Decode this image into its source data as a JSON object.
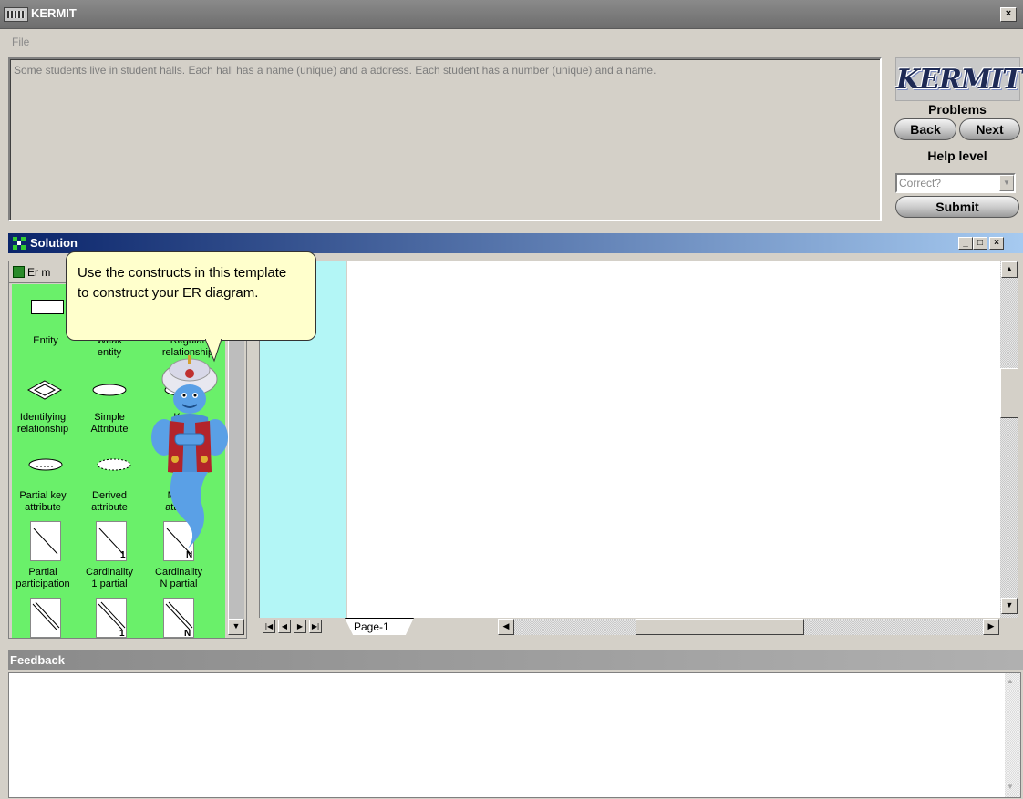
{
  "window": {
    "title": "KERMIT",
    "close_label": "×"
  },
  "menu": {
    "items": [
      {
        "label": "File"
      }
    ]
  },
  "problem": {
    "text": "Some students live in student halls. Each hall has a name (unique) and a address. Each student has a number (unique) and a name."
  },
  "sidebar": {
    "logo_text": "KERMIT",
    "problems_label": "Problems",
    "back_label": "Back",
    "next_label": "Next",
    "help_level_label": "Help level",
    "help_level_value": "Correct?",
    "submit_label": "Submit"
  },
  "solution": {
    "title": "Solution",
    "minimize": "_",
    "maximize": "□",
    "close": "×",
    "palette_title": "Er m",
    "palette": [
      {
        "label": [
          "Entity"
        ]
      },
      {
        "label": [
          "Weak",
          "entity"
        ]
      },
      {
        "label": [
          "Regular",
          "relationship"
        ]
      },
      {
        "label": [
          "Identifying",
          "relationship"
        ]
      },
      {
        "label": [
          "Simple",
          "Attribute"
        ]
      },
      {
        "label": [
          "K",
          ""
        ]
      },
      {
        "label": [
          "Partial key",
          "attribute"
        ]
      },
      {
        "label": [
          "Derived",
          "attribute"
        ]
      },
      {
        "label": [
          "Multiva",
          "attribute"
        ]
      },
      {
        "label": [
          "Partial",
          "participation"
        ]
      },
      {
        "label": [
          "Cardinality",
          "1 partial"
        ]
      },
      {
        "label": [
          "Cardinality",
          "N partial"
        ]
      }
    ],
    "cardinality_marks": {
      "one": "1",
      "n": "N"
    },
    "page_tab": "Page-1"
  },
  "genie": {
    "tip": "Use the constructs in this template to construct your ER diagram."
  },
  "feedback": {
    "title": "Feedback",
    "text": ""
  },
  "colors": {
    "palette_bg": "#6af06a",
    "canvas_margin": "#b3f6f6",
    "title_active": "#0a246a",
    "tip_bg": "#ffffcc"
  }
}
